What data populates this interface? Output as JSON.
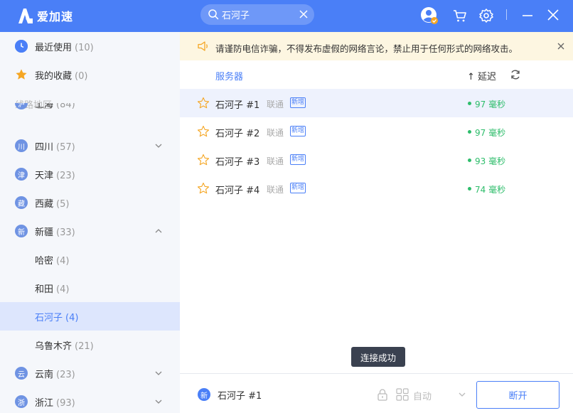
{
  "app": {
    "name": "爱加速",
    "brand_color": "#4a7ff7"
  },
  "search": {
    "value": "石河子",
    "icon": "search-icon"
  },
  "header_icons": [
    "user-avatar-icon",
    "cart-icon",
    "gear-icon",
    "minimize-icon",
    "close-icon"
  ],
  "sidebar": {
    "recent": {
      "label": "最近使用",
      "count": "(10)"
    },
    "favorites": {
      "label": "我的收藏",
      "count": "(0)"
    },
    "section_label": "线路地区",
    "regions": [
      {
        "badge": "沪",
        "label": "上海",
        "count": "(84)"
      },
      {
        "badge": "川",
        "label": "四川",
        "count": "(57)"
      },
      {
        "badge": "津",
        "label": "天津",
        "count": "(23)"
      },
      {
        "badge": "藏",
        "label": "西藏",
        "count": "(5)"
      },
      {
        "badge": "新",
        "label": "新疆",
        "count": "(33)"
      },
      {
        "label": "哈密",
        "count": "(4)"
      },
      {
        "label": "和田",
        "count": "(4)"
      },
      {
        "label": "石河子",
        "count": "(4)"
      },
      {
        "label": "乌鲁木齐",
        "count": "(21)"
      },
      {
        "badge": "云",
        "label": "云南",
        "count": "(23)"
      },
      {
        "badge": "浙",
        "label": "浙江",
        "count": "(93)"
      }
    ]
  },
  "notice": {
    "text": "请谨防电信诈骗，不得发布虚假的网络言论，禁止用于任何形式的网络攻击。"
  },
  "table": {
    "col_server": "服务器",
    "col_delay": "↑ 延迟",
    "rows": [
      {
        "name": "石河子 #1",
        "isp": "联通",
        "badge": "新增",
        "latency": "97 毫秒"
      },
      {
        "name": "石河子 #2",
        "isp": "联通",
        "badge": "新增",
        "latency": "97 毫秒"
      },
      {
        "name": "石河子 #3",
        "isp": "联通",
        "badge": "新增",
        "latency": "93 毫秒"
      },
      {
        "name": "石河子 #4",
        "isp": "联通",
        "badge": "新增",
        "latency": "74 毫秒"
      }
    ]
  },
  "toast": {
    "text": "连接成功"
  },
  "bottom": {
    "badge": "新",
    "current": "石河子 #1",
    "mode": "自动",
    "disconnect_label": "断开"
  }
}
